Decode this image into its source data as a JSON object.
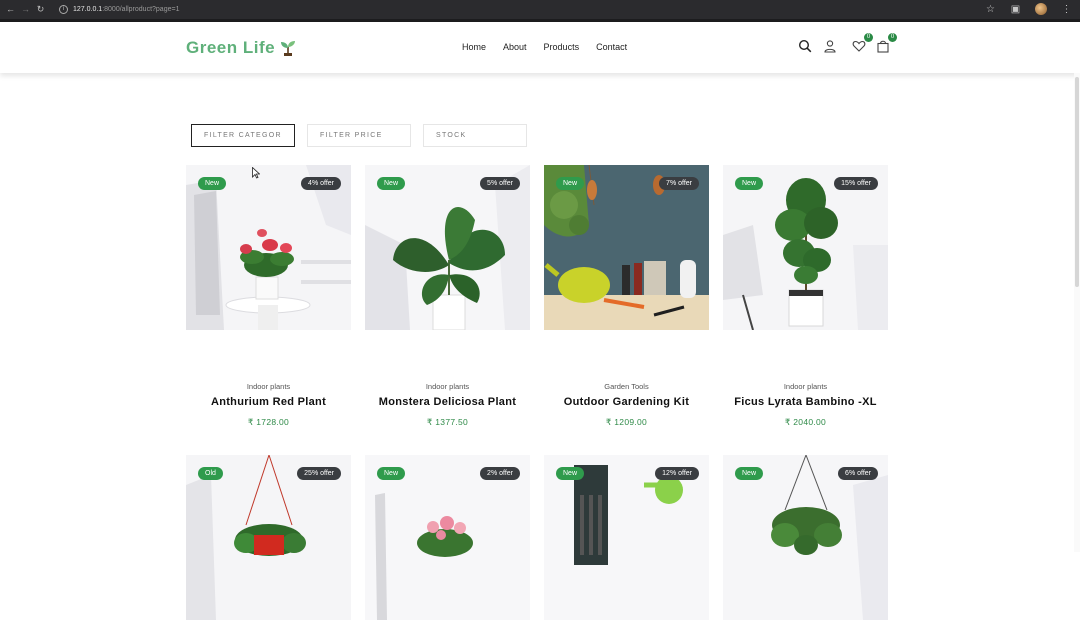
{
  "browser": {
    "url_host": "127.0.0.1",
    "url_path": ":8000/allproduct?page=1"
  },
  "site": {
    "logo": "Green Life",
    "nav": [
      "Home",
      "About",
      "Products",
      "Contact"
    ],
    "wishlist_count": "0",
    "cart_count": "0"
  },
  "filters": [
    "FILTER CATEGOR",
    "FILTER PRICE",
    "STOCK"
  ],
  "products": [
    {
      "badge": "New",
      "offer": "4% offer",
      "category": "Indoor plants",
      "name": "Anthurium Red Plant",
      "price": "₹ 1728.00"
    },
    {
      "badge": "New",
      "offer": "5% offer",
      "category": "Indoor plants",
      "name": "Monstera Deliciosa Plant",
      "price": "₹ 1377.50"
    },
    {
      "badge": "New",
      "offer": "7% offer",
      "category": "Garden Tools",
      "name": "Outdoor Gardening Kit",
      "price": "₹ 1209.00"
    },
    {
      "badge": "New",
      "offer": "15% offer",
      "category": "Indoor plants",
      "name": "Ficus Lyrata Bambino -XL",
      "price": "₹ 2040.00"
    },
    {
      "badge": "Old",
      "offer": "25% offer"
    },
    {
      "badge": "New",
      "offer": "2% offer"
    },
    {
      "badge": "New",
      "offer": "12% offer"
    },
    {
      "badge": "New",
      "offer": "6% offer"
    }
  ],
  "colors": {
    "brand_green": "#5fb07a",
    "badge_green": "#2f9b4c",
    "offer_dark": "#3a3d41",
    "price_green": "#2f8a48"
  }
}
